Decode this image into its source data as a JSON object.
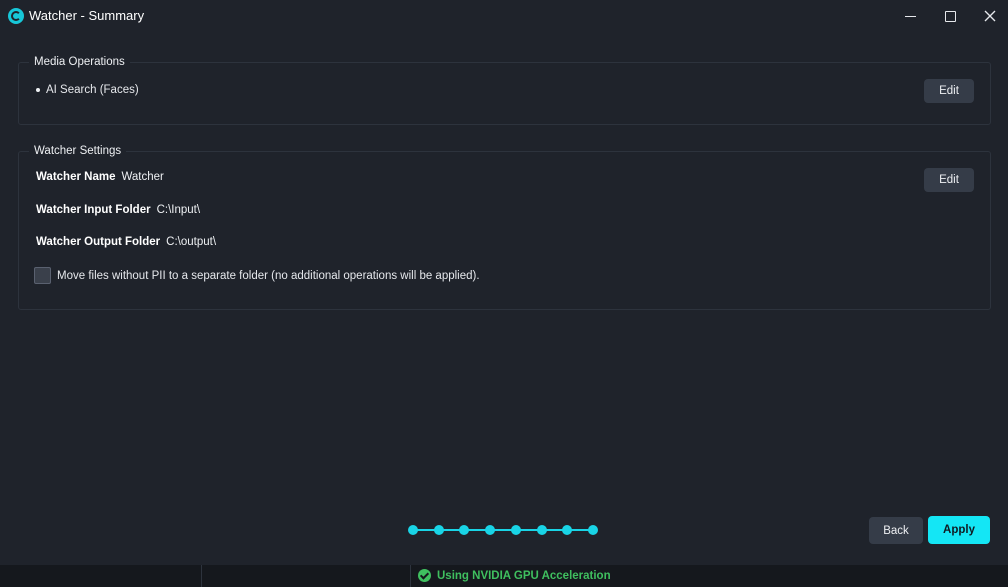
{
  "window": {
    "title": "Watcher - Summary"
  },
  "media_operations": {
    "legend": "Media Operations",
    "items": [
      "AI Search (Faces)"
    ],
    "edit_label": "Edit"
  },
  "watcher_settings": {
    "legend": "Watcher Settings",
    "edit_label": "Edit",
    "name_label": "Watcher Name",
    "name_value": "Watcher",
    "input_label": "Watcher Input Folder",
    "input_value": "C:\\Input\\",
    "output_label": "Watcher Output Folder",
    "output_value": "C:\\output\\",
    "move_files_checkbox_label": "Move files without PII to a separate folder (no additional operations will be applied).",
    "move_files_checked": false
  },
  "wizard": {
    "total_steps": 8,
    "current_step": 8,
    "back_label": "Back",
    "apply_label": "Apply"
  },
  "status_bar": {
    "gpu_text": "Using NVIDIA GPU Acceleration"
  },
  "colors": {
    "accent": "#14e6f5",
    "background": "#1f232b",
    "status_success": "#3fbf5f"
  }
}
